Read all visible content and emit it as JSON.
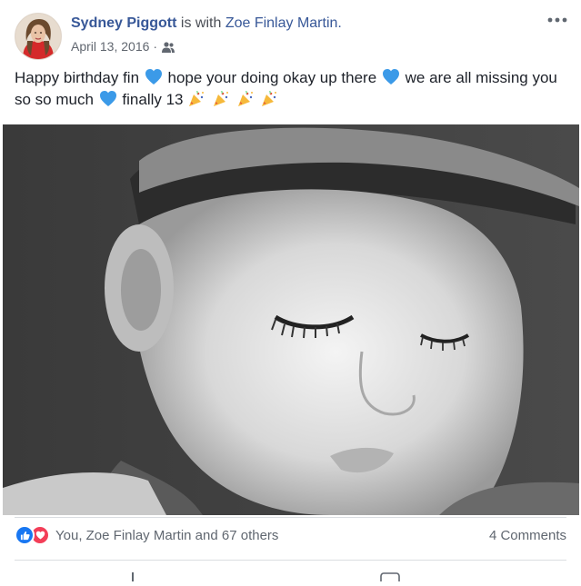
{
  "post": {
    "author": "Sydney Piggott",
    "with_text": "is with",
    "tagged": "Zoe Finlay Martin.",
    "date": "April 13, 2016",
    "meta_separator": "·",
    "audience_icon": "friends-icon",
    "more_icon": "more-horizontal-icon",
    "text_line_1": "Happy birthday fin",
    "text_line_2": "hope your doing okay up there",
    "text_line_3": "we are all missing you so so much",
    "text_line_4": "finally 13",
    "emoji": {
      "heart": "blue-heart-icon",
      "party": "party-popper-icon",
      "party_count": 4
    }
  },
  "photo": {
    "subject": "black and white photo of a child wearing a cap"
  },
  "footer": {
    "reaction_icons": [
      "like-icon",
      "love-icon"
    ],
    "reactors": "You, Zoe Finlay Martin and 67 others",
    "comments": "4 Comments"
  },
  "colors": {
    "link": "#385898",
    "meta": "#616770",
    "heart": "#3b9ae8",
    "like": "#1877f2",
    "love": "#f33e58",
    "divider": "#dadde1"
  }
}
